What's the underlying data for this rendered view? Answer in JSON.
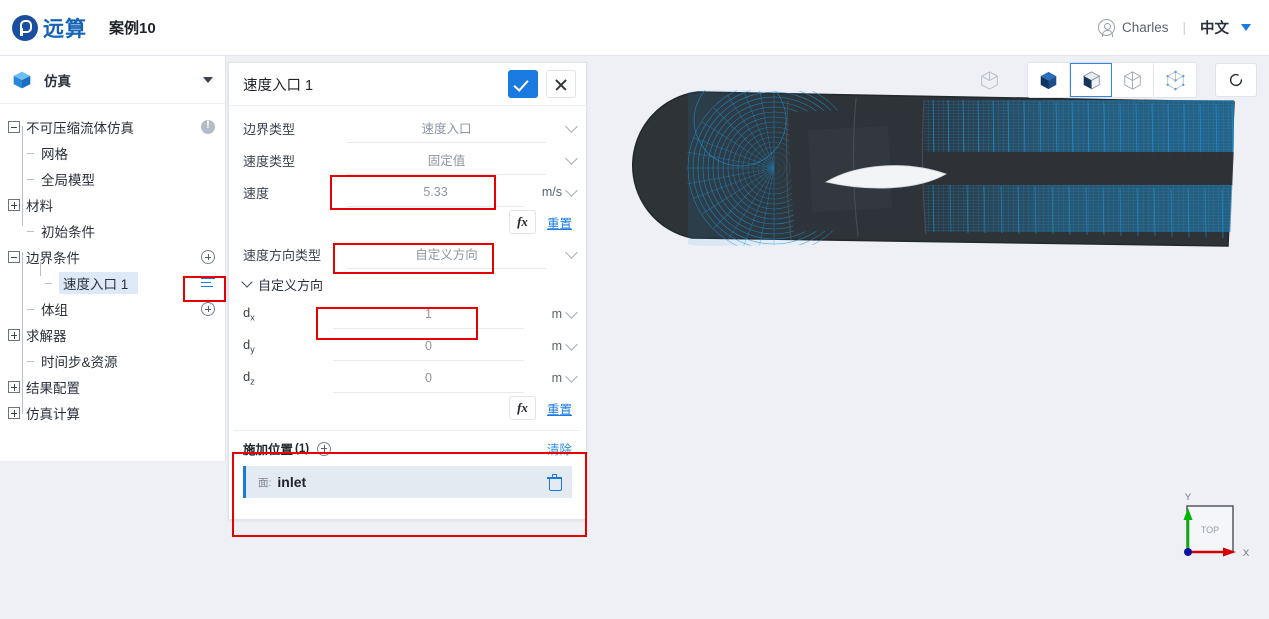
{
  "app": {
    "logo_text": "远算",
    "project_name": "案例10"
  },
  "topbar": {
    "user_name": "Charles",
    "separator": "|",
    "language": "中文",
    "avatar_icon": "user-circle-icon",
    "caret_icon": "chevron-down-icon"
  },
  "sidebar": {
    "header": {
      "label": "仿真",
      "icon": "cube-icon",
      "caret": "caret-down-icon"
    },
    "tree": [
      {
        "label": "不可压缩流体仿真",
        "level": 0,
        "toggle": "minus",
        "right_icon": "warning-icon"
      },
      {
        "label": "网格",
        "level": 1,
        "toggle": "none",
        "right_icon": "none"
      },
      {
        "label": "全局模型",
        "level": 1,
        "toggle": "none",
        "right_icon": "none"
      },
      {
        "label": "材料",
        "level": 0,
        "toggle": "plus",
        "right_icon": "none"
      },
      {
        "label": "初始条件",
        "level": 1,
        "toggle": "none",
        "right_icon": "none"
      },
      {
        "label": "边界条件",
        "level": 0,
        "toggle": "minus",
        "right_icon": "plus-circle-icon"
      },
      {
        "label": "速度入口 1",
        "level": 2,
        "toggle": "none",
        "right_icon": "list-icon",
        "selected": true
      },
      {
        "label": "体组",
        "level": 1,
        "toggle": "none",
        "right_icon": "plus-circle-icon"
      },
      {
        "label": "求解器",
        "level": 0,
        "toggle": "plus",
        "right_icon": "none"
      },
      {
        "label": "时间步&资源",
        "level": 1,
        "toggle": "none",
        "right_icon": "none"
      },
      {
        "label": "结果配置",
        "level": 0,
        "toggle": "plus",
        "right_icon": "none"
      },
      {
        "label": "仿真计算",
        "level": 0,
        "toggle": "plus",
        "right_icon": "none"
      }
    ]
  },
  "panel": {
    "title": "速度入口 1",
    "confirm_icon": "check-icon",
    "close_icon": "close-icon",
    "fields": [
      {
        "label": "边界类型",
        "value": "速度入口",
        "unit": "",
        "control": "select"
      },
      {
        "label": "速度类型",
        "value": "固定值",
        "unit": "",
        "control": "select"
      },
      {
        "label": "速度",
        "value": "5.33",
        "unit": "m/s",
        "control": "input-unit"
      }
    ],
    "fx_label": "fx",
    "reset_label": "重置",
    "direction_type": {
      "label": "速度方向类型",
      "value": "自定义方向",
      "control": "select"
    },
    "section": {
      "label": "自定义方向",
      "chevron": "chevron-down-icon"
    },
    "direction_fields": [
      {
        "label": "d",
        "sub": "x",
        "value": "1",
        "unit": "m"
      },
      {
        "label": "d",
        "sub": "y",
        "value": "0",
        "unit": "m"
      },
      {
        "label": "d",
        "sub": "z",
        "value": "0",
        "unit": "m"
      }
    ],
    "assignment": {
      "title": "施加位置",
      "count": "(1)",
      "add_icon": "plus-circle-icon",
      "clear_label": "清除",
      "items": [
        {
          "kind": "面:",
          "name": "inlet",
          "delete_icon": "trash-icon"
        }
      ]
    }
  },
  "viewport": {
    "toolbar": [
      {
        "name": "wireframe-cube-view-icon",
        "active": false,
        "style": "ghost"
      },
      {
        "name": "solid-cube-view-icon",
        "active": false,
        "style": "grouped"
      },
      {
        "name": "surface-cube-view-icon",
        "active": true,
        "style": "grouped"
      },
      {
        "name": "wireframe-edges-view-icon",
        "active": false,
        "style": "grouped"
      },
      {
        "name": "points-cube-view-icon",
        "active": false,
        "style": "grouped"
      },
      {
        "name": "reset-view-icon",
        "active": false,
        "style": "single"
      }
    ],
    "axis": {
      "label": "TOP",
      "x_label": "X",
      "y_label": "Y",
      "x_color": "#d40000",
      "y_color": "#00b300",
      "origin_color": "#1010a0"
    },
    "model": {
      "description": "airfoil-cfd-mesh"
    }
  },
  "colors": {
    "accent": "#1a7ae0",
    "brand": "#1563b6",
    "annotation": "#e60000",
    "mesh": "#1f9be0",
    "panel_bg": "#ffffff",
    "app_bg": "#eef0f5"
  }
}
